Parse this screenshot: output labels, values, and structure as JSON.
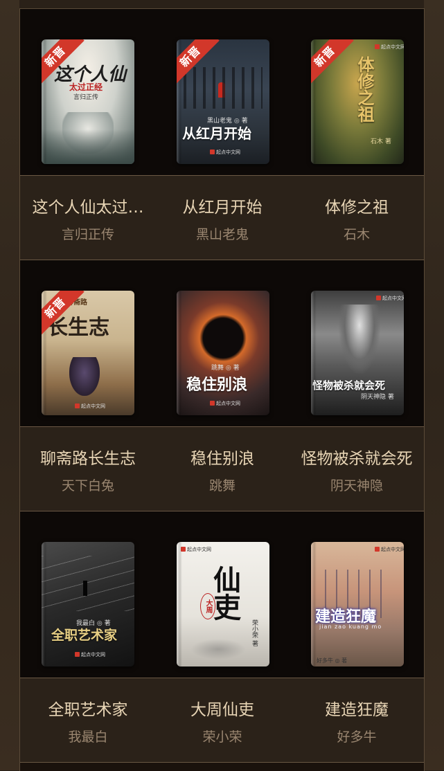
{
  "badge_label": "新晋",
  "rows": [
    {
      "books": [
        {
          "title": "这个人仙太过…",
          "author": "言归正传",
          "cover_title": "这个人仙",
          "cover_subtitle": "太过正经",
          "cover_author": "言归正传",
          "badge": true
        },
        {
          "title": "从红月开始",
          "author": "黑山老鬼",
          "cover_title": "从红月开始",
          "cover_author": "黑山老鬼 ◎ 著",
          "publisher": "起点中文网",
          "badge": true
        },
        {
          "title": "体修之祖",
          "author": "石木",
          "cover_title": "体修之祖",
          "cover_author": "石木 著",
          "publisher": "起点中文网",
          "badge": true
        }
      ]
    },
    {
      "books": [
        {
          "title": "聊斋路长生志",
          "author": "天下白兔",
          "cover_title": "长生志",
          "cover_subtitle": "聊斋路",
          "publisher": "起点中文网",
          "badge": true
        },
        {
          "title": "稳住别浪",
          "author": "跳舞",
          "cover_title": "稳住别浪",
          "cover_author": "跳舞 ◎ 著",
          "publisher": "起点中文网",
          "badge": false
        },
        {
          "title": "怪物被杀就会死",
          "author": "阴天神隐",
          "cover_title": "怪物被杀就会死",
          "cover_author": "阴天神隐 著",
          "publisher": "起点中文网",
          "badge": false
        }
      ]
    },
    {
      "books": [
        {
          "title": "全职艺术家",
          "author": "我最白",
          "cover_title": "全职艺术家",
          "cover_author": "我最白 ◎ 著",
          "publisher": "起点中文网",
          "badge": false
        },
        {
          "title": "大周仙吏",
          "author": "荣小荣",
          "cover_title": "仙吏",
          "cover_subtitle": "大周",
          "cover_author": "荣小荣 著",
          "publisher": "起点中文网",
          "badge": false
        },
        {
          "title": "建造狂魔",
          "author": "好多牛",
          "cover_title": "建造狂魔",
          "cover_subtitle": "jian zao kuang mo",
          "cover_author": "好多牛 ◎ 著",
          "publisher": "起点中文网",
          "badge": false
        }
      ]
    }
  ],
  "colors": {
    "page_bg": "#2a2118",
    "cover_band": "#0d0907",
    "text_band": "#2b2219",
    "title_text": "#e8d5b5",
    "author_text": "#9a8670",
    "badge": "#d2372a"
  }
}
